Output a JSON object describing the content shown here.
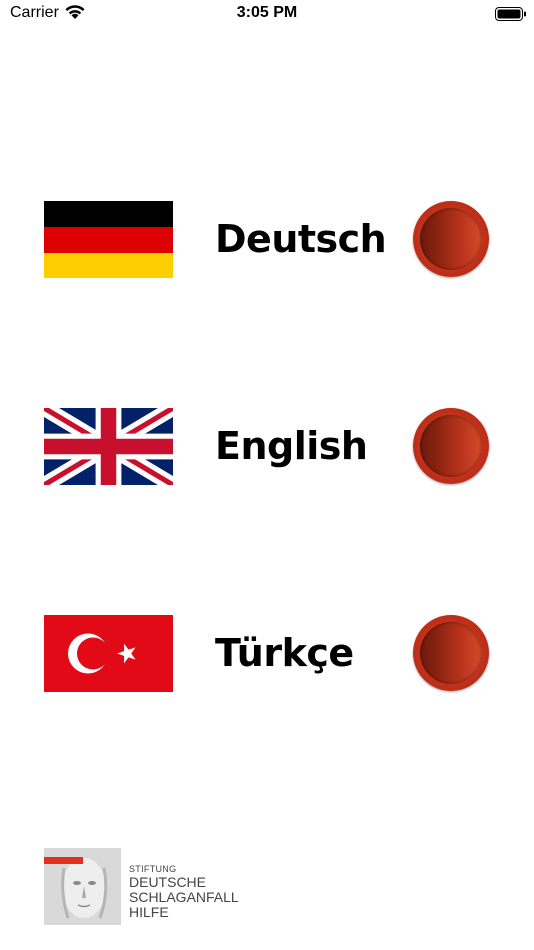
{
  "status_bar": {
    "carrier": "Carrier",
    "time": "3:05 PM",
    "wifi_icon": "wifi-icon",
    "battery_icon": "battery-icon"
  },
  "languages": [
    {
      "label": "Deutsch",
      "flag_icon": "german-flag-icon"
    },
    {
      "label": "English",
      "flag_icon": "uk-flag-icon"
    },
    {
      "label": "Türkçe",
      "flag_icon": "turkish-flag-icon"
    }
  ],
  "colors": {
    "button_red": "#c2311a",
    "button_dark": "#6b1a0c",
    "turkey_red": "#e30a17",
    "de_black": "#000000",
    "de_red": "#dd0000",
    "de_gold": "#ffce00",
    "uk_blue": "#012169",
    "uk_red": "#c8102e"
  },
  "logo": {
    "line1": "STIFTUNG",
    "line2": "DEUTSCHE",
    "line3": "SCHLAGANFALL",
    "line4": "HILFE"
  }
}
